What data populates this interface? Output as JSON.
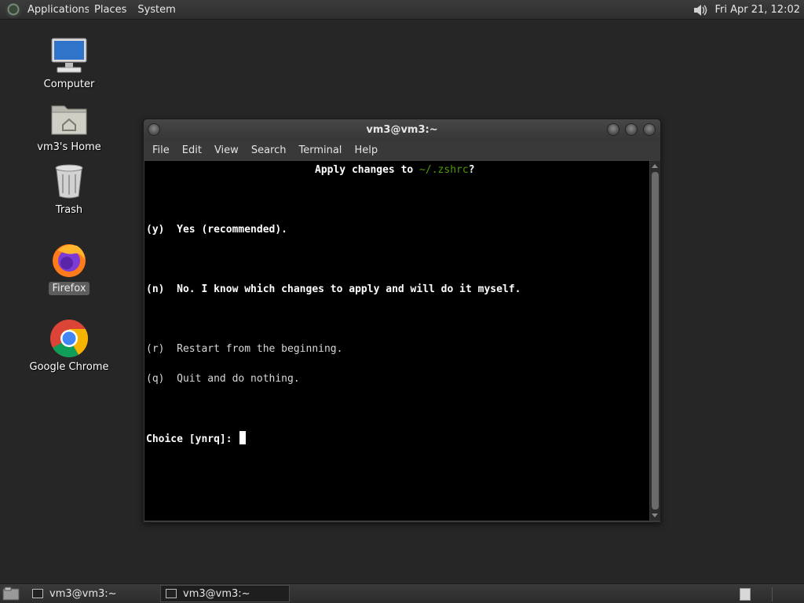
{
  "top_panel": {
    "applications": "Applications",
    "places": "Places",
    "system": "System",
    "clock": "Fri Apr 21, 12:02"
  },
  "desktop": {
    "icons": [
      {
        "label": "Computer",
        "icon": "computer-icon"
      },
      {
        "label": "vm3's Home",
        "icon": "home-folder-icon"
      },
      {
        "label": "Trash",
        "icon": "trash-icon"
      },
      {
        "label": "Firefox",
        "icon": "firefox-icon"
      },
      {
        "label": "Google Chrome",
        "icon": "chrome-icon"
      }
    ]
  },
  "terminal": {
    "title": "vm3@vm3:~",
    "menu": [
      "File",
      "Edit",
      "View",
      "Search",
      "Terminal",
      "Help"
    ],
    "lines": {
      "apply_prefix": "Apply changes to ",
      "apply_path": "~/.zshrc",
      "apply_suffix": "?",
      "opt_y": "(y)  Yes (recommended).",
      "opt_n": "(n)  No. I know which changes to apply and will do it myself.",
      "opt_r": "(r)  Restart from the beginning.",
      "opt_q": "(q)  Quit and do nothing.",
      "prompt": "Choice [ynrq]: "
    }
  },
  "taskbar": {
    "tasks": [
      {
        "label": "vm3@vm3:~"
      },
      {
        "label": "vm3@vm3:~"
      }
    ]
  }
}
